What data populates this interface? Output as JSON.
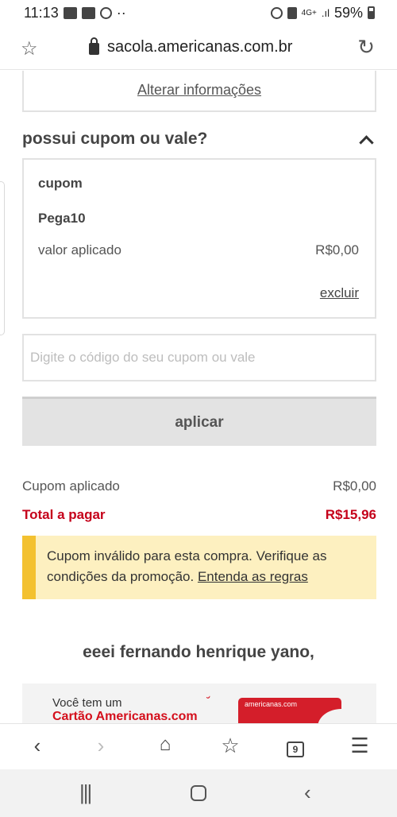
{
  "status_bar": {
    "time": "11:13",
    "extra": "··",
    "network": "4G+",
    "battery": "59%"
  },
  "browser": {
    "url": "sacola.americanas.com.br"
  },
  "address": {
    "edit_label": "Alterar informações"
  },
  "coupon_section": {
    "title": "possui cupom ou vale?",
    "card": {
      "title": "cupom",
      "code": "Pega10",
      "applied_label": "valor aplicado",
      "applied_value": "R$0,00",
      "remove_label": "excluir"
    },
    "input_placeholder": "Digite o código do seu cupom ou vale",
    "apply_label": "aplicar"
  },
  "summary": {
    "coupon_label": "Cupom aplicado",
    "coupon_value": "R$0,00",
    "total_label": "Total a pagar",
    "total_value": "R$15,96"
  },
  "alert": {
    "message": "Cupom inválido para esta compra. Verifique as condições da promoção.",
    "link": "Entenda as regras"
  },
  "greeting": "eeei fernando henrique yano,",
  "promo": {
    "line1": "Você tem um",
    "line2": "Cartão Americanas.com",
    "card_brand": "americanas.com"
  },
  "bottom_nav": {
    "tab_count": "9"
  }
}
